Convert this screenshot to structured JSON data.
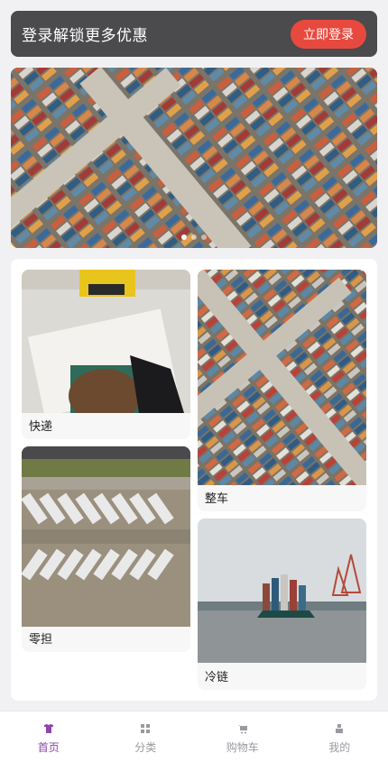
{
  "login_banner": {
    "text": "登录解锁更多优惠",
    "button_label": "立即登录"
  },
  "hero": {
    "slide_count": 3,
    "active_slide": 1
  },
  "categories": [
    {
      "label": "快递"
    },
    {
      "label": "整车"
    },
    {
      "label": "零担"
    },
    {
      "label": "冷链"
    }
  ],
  "tabbar": {
    "items": [
      {
        "label": "首页",
        "icon": "shirt-icon",
        "active": true
      },
      {
        "label": "分类",
        "icon": "grid-icon",
        "active": false
      },
      {
        "label": "购物车",
        "icon": "cart-icon",
        "active": false
      },
      {
        "label": "我的",
        "icon": "person-icon",
        "active": false
      }
    ]
  },
  "colors": {
    "accent": "#8e44ad",
    "login_button": "#e8493e",
    "banner_bg": "#4b4a4c"
  }
}
